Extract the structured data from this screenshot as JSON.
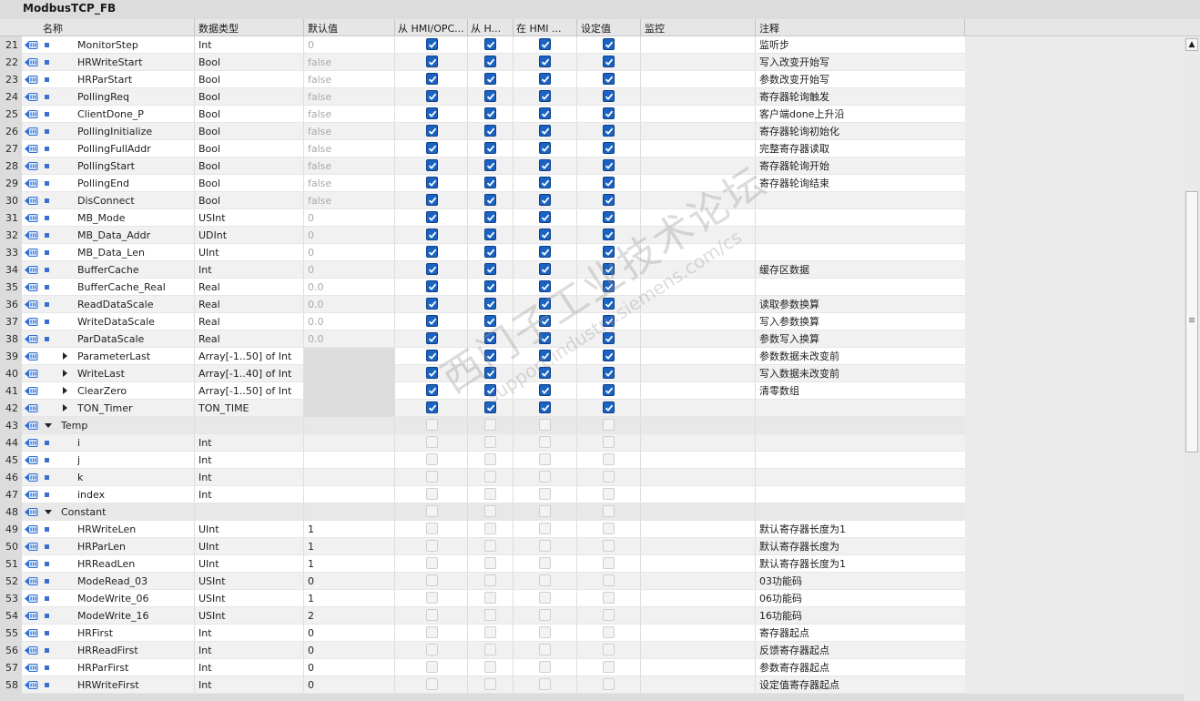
{
  "window": {
    "title": "ModbusTCP_FB"
  },
  "columns": [
    "名称",
    "数据类型",
    "默认值",
    "从 HMI/OPC...",
    "从 H...",
    "在 HMI ...",
    "设定值",
    "监控",
    "注释"
  ],
  "watermark": {
    "line1": "西门子工业技术论坛",
    "line2": "support.industry.siemens.com/cs"
  },
  "rows": [
    {
      "n": "21",
      "kind": "item",
      "name": "MonitorStep",
      "type": "Int",
      "def": "0",
      "defDim": true,
      "cb": [
        1,
        1,
        1,
        1
      ],
      "comment": "监听步"
    },
    {
      "n": "22",
      "kind": "item",
      "name": "HRWriteStart",
      "type": "Bool",
      "def": "false",
      "defDim": true,
      "cb": [
        1,
        1,
        1,
        1
      ],
      "comment": "写入改变开始写"
    },
    {
      "n": "23",
      "kind": "item",
      "name": "HRParStart",
      "type": "Bool",
      "def": "false",
      "defDim": true,
      "cb": [
        1,
        1,
        1,
        1
      ],
      "comment": "参数改变开始写"
    },
    {
      "n": "24",
      "kind": "item",
      "name": "PollingReq",
      "type": "Bool",
      "def": "false",
      "defDim": true,
      "cb": [
        1,
        1,
        1,
        1
      ],
      "comment": "寄存器轮询触发"
    },
    {
      "n": "25",
      "kind": "item",
      "name": "ClientDone_P",
      "type": "Bool",
      "def": "false",
      "defDim": true,
      "cb": [
        1,
        1,
        1,
        1
      ],
      "comment": "客户端done上升沿"
    },
    {
      "n": "26",
      "kind": "item",
      "name": "PollingInitialize",
      "type": "Bool",
      "def": "false",
      "defDim": true,
      "cb": [
        1,
        1,
        1,
        1
      ],
      "comment": "寄存器轮询初始化"
    },
    {
      "n": "27",
      "kind": "item",
      "name": "PollingFullAddr",
      "type": "Bool",
      "def": "false",
      "defDim": true,
      "cb": [
        1,
        1,
        1,
        1
      ],
      "comment": "完整寄存器读取"
    },
    {
      "n": "28",
      "kind": "item",
      "name": "PollingStart",
      "type": "Bool",
      "def": "false",
      "defDim": true,
      "cb": [
        1,
        1,
        1,
        1
      ],
      "comment": "寄存器轮询开始"
    },
    {
      "n": "29",
      "kind": "item",
      "name": "PollingEnd",
      "type": "Bool",
      "def": "false",
      "defDim": true,
      "cb": [
        1,
        1,
        1,
        1
      ],
      "comment": "寄存器轮询结束"
    },
    {
      "n": "30",
      "kind": "item",
      "name": "DisConnect",
      "type": "Bool",
      "def": "false",
      "defDim": true,
      "cb": [
        1,
        1,
        1,
        1
      ],
      "comment": ""
    },
    {
      "n": "31",
      "kind": "item",
      "name": "MB_Mode",
      "type": "USInt",
      "def": "0",
      "defDim": true,
      "cb": [
        1,
        1,
        1,
        1
      ],
      "comment": ""
    },
    {
      "n": "32",
      "kind": "item",
      "name": "MB_Data_Addr",
      "type": "UDInt",
      "def": "0",
      "defDim": true,
      "cb": [
        1,
        1,
        1,
        1
      ],
      "comment": ""
    },
    {
      "n": "33",
      "kind": "item",
      "name": "MB_Data_Len",
      "type": "UInt",
      "def": "0",
      "defDim": true,
      "cb": [
        1,
        1,
        1,
        1
      ],
      "comment": ""
    },
    {
      "n": "34",
      "kind": "item",
      "name": "BufferCache",
      "type": "Int",
      "def": "0",
      "defDim": true,
      "cb": [
        1,
        1,
        1,
        1
      ],
      "comment": "缓存区数据"
    },
    {
      "n": "35",
      "kind": "item",
      "name": "BufferCache_Real",
      "type": "Real",
      "def": "0.0",
      "defDim": true,
      "cb": [
        1,
        1,
        1,
        1
      ],
      "comment": ""
    },
    {
      "n": "36",
      "kind": "item",
      "name": "ReadDataScale",
      "type": "Real",
      "def": "0.0",
      "defDim": true,
      "cb": [
        1,
        1,
        1,
        1
      ],
      "comment": "读取参数换算"
    },
    {
      "n": "37",
      "kind": "item",
      "name": "WriteDataScale",
      "type": "Real",
      "def": "0.0",
      "defDim": true,
      "cb": [
        1,
        1,
        1,
        1
      ],
      "comment": "写入参数换算"
    },
    {
      "n": "38",
      "kind": "item",
      "name": "ParDataScale",
      "type": "Real",
      "def": "0.0",
      "defDim": true,
      "cb": [
        1,
        1,
        1,
        1
      ],
      "comment": "参数写入换算"
    },
    {
      "n": "39",
      "kind": "group",
      "name": "ParameterLast",
      "type": "Array[-1..50] of Int",
      "def": "",
      "cb": [
        1,
        1,
        1,
        1
      ],
      "comment": "参数数据未改变前"
    },
    {
      "n": "40",
      "kind": "group",
      "name": "WriteLast",
      "type": "Array[-1..40] of Int",
      "def": "",
      "cb": [
        1,
        1,
        1,
        1
      ],
      "comment": "写入数据未改变前"
    },
    {
      "n": "41",
      "kind": "group",
      "name": "ClearZero",
      "type": "Array[-1..50] of Int",
      "def": "",
      "cb": [
        1,
        1,
        1,
        1
      ],
      "comment": "清零数组"
    },
    {
      "n": "42",
      "kind": "group",
      "name": "TON_Timer",
      "type": "TON_TIME",
      "def": "",
      "cb": [
        1,
        1,
        1,
        1
      ],
      "comment": ""
    },
    {
      "n": "43",
      "kind": "section",
      "name": "Temp",
      "type": "",
      "def": "",
      "cb": [
        0,
        0,
        0,
        0
      ],
      "comment": ""
    },
    {
      "n": "44",
      "kind": "item",
      "name": "i",
      "type": "Int",
      "def": "",
      "cb": [
        0,
        0,
        0,
        0
      ],
      "comment": ""
    },
    {
      "n": "45",
      "kind": "item",
      "name": "j",
      "type": "Int",
      "def": "",
      "cb": [
        0,
        0,
        0,
        0
      ],
      "comment": ""
    },
    {
      "n": "46",
      "kind": "item",
      "name": "k",
      "type": "Int",
      "def": "",
      "cb": [
        0,
        0,
        0,
        0
      ],
      "comment": ""
    },
    {
      "n": "47",
      "kind": "item",
      "name": "index",
      "type": "Int",
      "def": "",
      "cb": [
        0,
        0,
        0,
        0
      ],
      "comment": ""
    },
    {
      "n": "48",
      "kind": "section",
      "name": "Constant",
      "type": "",
      "def": "",
      "cb": [
        0,
        0,
        0,
        0
      ],
      "comment": ""
    },
    {
      "n": "49",
      "kind": "item",
      "name": "HRWriteLen",
      "type": "UInt",
      "def": "1",
      "cb": [
        0,
        0,
        0,
        0
      ],
      "comment": "默认寄存器长度为1"
    },
    {
      "n": "50",
      "kind": "item",
      "name": "HRParLen",
      "type": "UInt",
      "def": "1",
      "cb": [
        0,
        0,
        0,
        0
      ],
      "comment": "默认寄存器长度为"
    },
    {
      "n": "51",
      "kind": "item",
      "name": "HRReadLen",
      "type": "UInt",
      "def": "1",
      "cb": [
        0,
        0,
        0,
        0
      ],
      "comment": "默认寄存器长度为1"
    },
    {
      "n": "52",
      "kind": "item",
      "name": "ModeRead_03",
      "type": "USInt",
      "def": "0",
      "cb": [
        0,
        0,
        0,
        0
      ],
      "comment": "03功能码"
    },
    {
      "n": "53",
      "kind": "item",
      "name": "ModeWrite_06",
      "type": "USInt",
      "def": "1",
      "cb": [
        0,
        0,
        0,
        0
      ],
      "comment": "06功能码"
    },
    {
      "n": "54",
      "kind": "item",
      "name": "ModeWrite_16",
      "type": "USInt",
      "def": "2",
      "cb": [
        0,
        0,
        0,
        0
      ],
      "comment": "16功能码"
    },
    {
      "n": "55",
      "kind": "item",
      "name": "HRFirst",
      "type": "Int",
      "def": "0",
      "cb": [
        0,
        0,
        0,
        0
      ],
      "comment": "寄存器起点"
    },
    {
      "n": "56",
      "kind": "item",
      "name": "HRReadFirst",
      "type": "Int",
      "def": "0",
      "cb": [
        0,
        0,
        0,
        0
      ],
      "comment": "反馈寄存器起点"
    },
    {
      "n": "57",
      "kind": "item",
      "name": "HRParFirst",
      "type": "Int",
      "def": "0",
      "cb": [
        0,
        0,
        0,
        0
      ],
      "comment": "参数寄存器起点"
    },
    {
      "n": "58",
      "kind": "item",
      "name": "HRWriteFirst",
      "type": "Int",
      "def": "0",
      "cb": [
        0,
        0,
        0,
        0
      ],
      "comment": "设定值寄存器起点"
    }
  ]
}
